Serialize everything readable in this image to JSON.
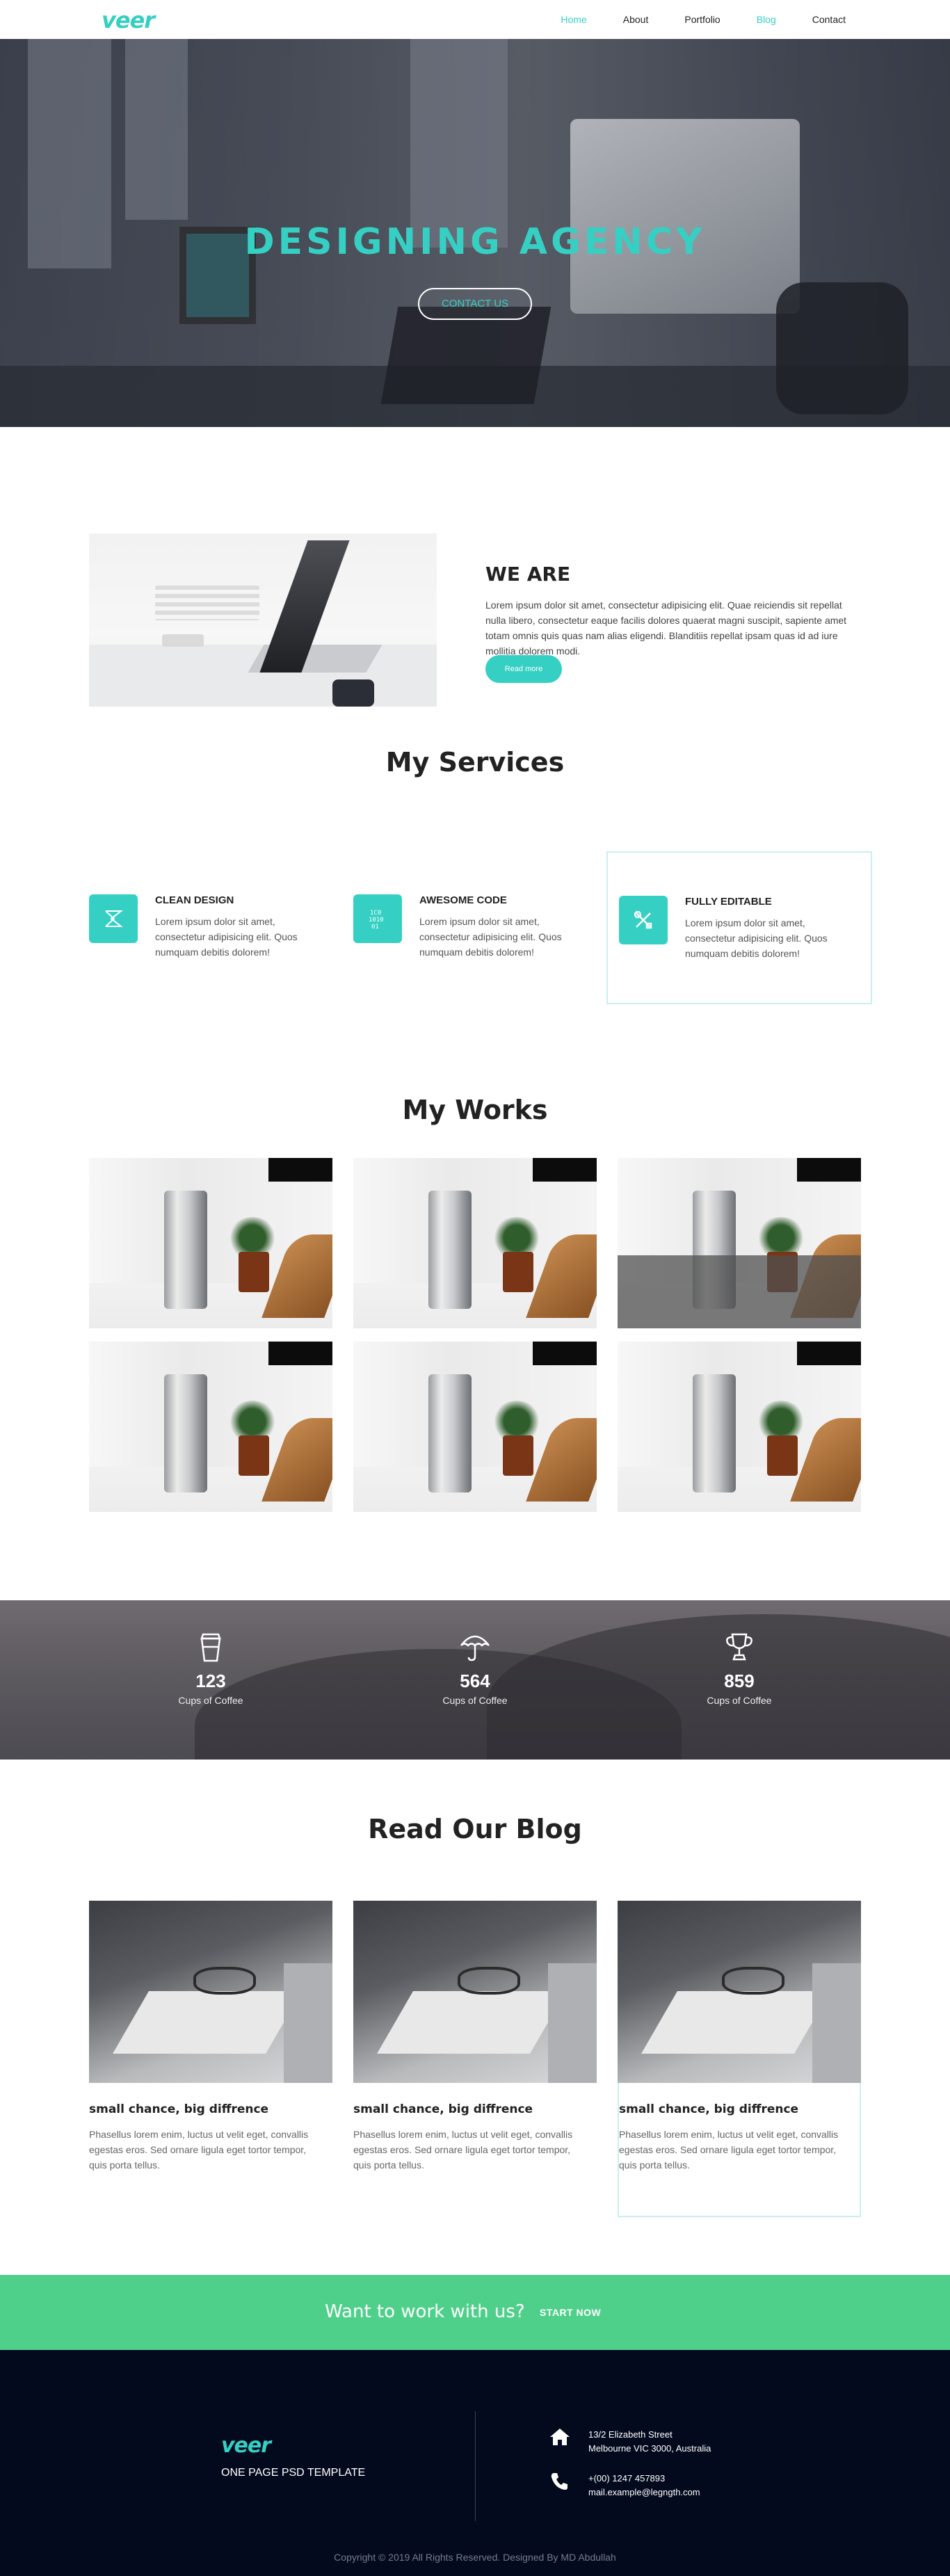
{
  "nav": {
    "logo": "veer",
    "items": [
      {
        "label": "Home",
        "active": true
      },
      {
        "label": "About",
        "active": false
      },
      {
        "label": "Portfolio",
        "active": false
      },
      {
        "label": "Blog",
        "active": true
      },
      {
        "label": "Contact",
        "active": false
      }
    ]
  },
  "hero": {
    "title": "DESIGNING AGENCY",
    "button": "CONTACT US"
  },
  "about": {
    "title": "WE ARE",
    "text": "Lorem ipsum dolor sit amet, consectetur adipisicing elit. Quae reiciendis sit repellat nulla libero, consectetur eaque facilis dolores quaerat magni suscipit, sapiente amet totam omnis quis quas nam alias eligendi. Blanditiis repellat ipsam quas id ad iure mollitia dolorem modi.",
    "button": "Read more"
  },
  "services": {
    "title": "My Services",
    "items": [
      {
        "icon": "design-icon",
        "name": "CLEAN DESIGN",
        "desc": "Lorem ipsum dolor sit amet, consectetur adipisicing elit. Quos numquam debitis dolorem!"
      },
      {
        "icon": "code-icon",
        "name": "AWESOME CODE",
        "desc": "Lorem ipsum dolor sit amet, consectetur adipisicing elit. Quos numquam debitis dolorem!"
      },
      {
        "icon": "tools-icon",
        "name": "FULLY EDITABLE",
        "desc": "Lorem ipsum dolor sit amet, consectetur adipisicing elit. Quos numquam debitis dolorem!"
      }
    ]
  },
  "works": {
    "title": "My Works"
  },
  "stats": [
    {
      "icon": "coffee-cup-icon",
      "number": "123",
      "label": "Cups of Coffee"
    },
    {
      "icon": "umbrella-icon",
      "number": "564",
      "label": "Cups of Coffee"
    },
    {
      "icon": "trophy-icon",
      "number": "859",
      "label": "Cups of Coffee"
    }
  ],
  "blog": {
    "title": "Read Our Blog",
    "posts": [
      {
        "title": "small chance, big diffrence",
        "text": "Phasellus lorem enim, luctus ut velit eget, convallis egestas eros. Sed ornare ligula eget tortor tempor, quis porta tellus."
      },
      {
        "title": "small chance, big diffrence",
        "text": "Phasellus lorem enim, luctus ut velit eget, convallis egestas eros. Sed ornare ligula eget tortor tempor, quis porta tellus."
      },
      {
        "title": "small chance, big diffrence",
        "text": "Phasellus lorem enim, luctus ut velit eget, convallis egestas eros. Sed ornare ligula eget tortor tempor, quis porta tellus."
      }
    ]
  },
  "cta": {
    "text": "Want to work with us?",
    "button": "START NOW"
  },
  "footer": {
    "logo": "veer",
    "tagline": "ONE PAGE PSD TEMPLATE",
    "address_line1": "13/2 Elizabeth Street",
    "address_line2": "Melbourne VIC 3000, Australia",
    "phone": "+(00) 1247 457893",
    "email": "mail.example@legngth.com",
    "copyright": "Copyright © 2019 All Rights Reserved. Designed By MD Abdullah"
  },
  "colors": {
    "accent": "#35d0c3",
    "cta_green": "#4fd08a",
    "footer_bg": "#040a1e"
  }
}
